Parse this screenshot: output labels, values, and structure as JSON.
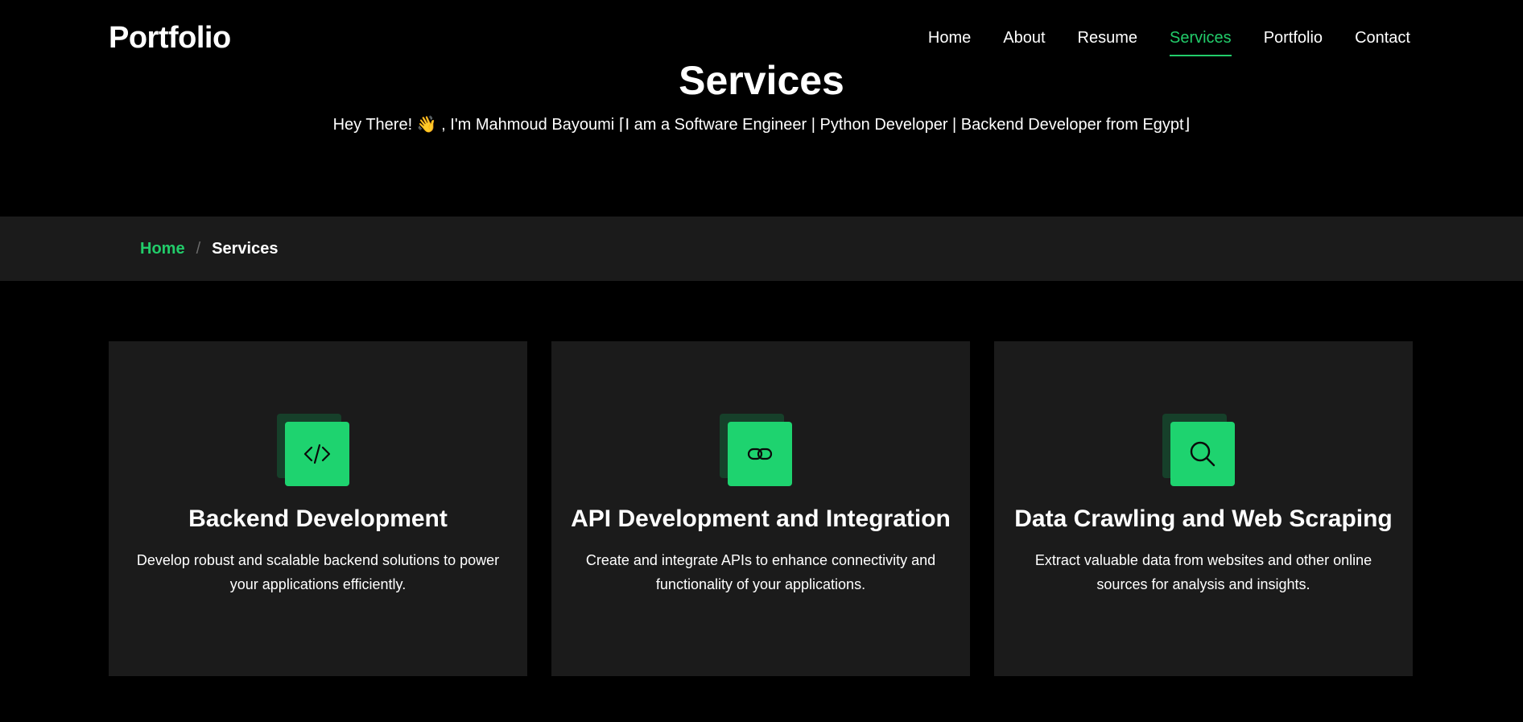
{
  "header": {
    "logo": "Portfolio",
    "nav": [
      {
        "label": "Home"
      },
      {
        "label": "About"
      },
      {
        "label": "Resume"
      },
      {
        "label": "Services",
        "active": true
      },
      {
        "label": "Portfolio"
      },
      {
        "label": "Contact"
      }
    ]
  },
  "hero": {
    "title": "Services",
    "subtitle": "Hey There! 👋 , I'm Mahmoud Bayoumi ⌈I am a Software Engineer | Python Developer | Backend Developer from Egypt⌋"
  },
  "breadcrumb": {
    "home": "Home",
    "separator": "/",
    "current": "Services"
  },
  "services": [
    {
      "icon": "code-icon",
      "title": "Backend Development",
      "description": "Develop robust and scalable backend solutions to power your applications efficiently."
    },
    {
      "icon": "link-icon",
      "title": "API Development and Integration",
      "description": "Create and integrate APIs to enhance connectivity and functionality of your applications."
    },
    {
      "icon": "search-icon",
      "title": "Data Crawling and Web Scraping",
      "description": "Extract valuable data from websites and other online sources for analysis and insights."
    }
  ],
  "colors": {
    "accent": "#22cc6a",
    "background": "#000000",
    "panel": "#1b1b1b"
  }
}
